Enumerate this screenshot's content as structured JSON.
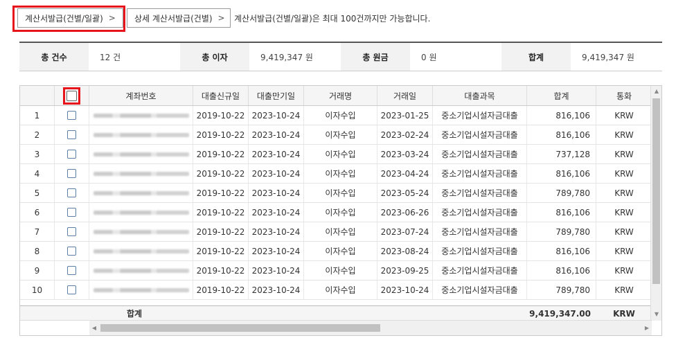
{
  "buttons": {
    "bulk_issue": "계산서발급(건별/일괄)",
    "detail_issue": "상세 계산서발급(건별)",
    "chevron": ">"
  },
  "notice": "계산서발급(건별/일괄)은 최대 100건까지만 가능합니다.",
  "summary": {
    "count_label": "총 건수",
    "count_value": "12 건",
    "interest_label": "총 이자",
    "interest_value": "9,419,347 원",
    "principal_label": "총 원금",
    "principal_value": "0 원",
    "total_label": "합계",
    "total_value": "9,419,347 원"
  },
  "table": {
    "headers": [
      "",
      "",
      "계좌번호",
      "대출신규일",
      "대출만기일",
      "거래명",
      "거래일",
      "대출과목",
      "합계",
      "통화"
    ],
    "rows": [
      {
        "no": "1",
        "open": "2019-10-22",
        "due": "2023-10-24",
        "type": "이자수입",
        "date": "2023-01-25",
        "product": "중소기업시설자금대출",
        "total": "816,106",
        "cur": "KRW"
      },
      {
        "no": "2",
        "open": "2019-10-22",
        "due": "2023-10-24",
        "type": "이자수입",
        "date": "2023-02-24",
        "product": "중소기업시설자금대출",
        "total": "816,106",
        "cur": "KRW"
      },
      {
        "no": "3",
        "open": "2019-10-22",
        "due": "2023-10-24",
        "type": "이자수입",
        "date": "2023-03-24",
        "product": "중소기업시설자금대출",
        "total": "737,128",
        "cur": "KRW"
      },
      {
        "no": "4",
        "open": "2019-10-22",
        "due": "2023-10-24",
        "type": "이자수입",
        "date": "2023-04-24",
        "product": "중소기업시설자금대출",
        "total": "816,106",
        "cur": "KRW"
      },
      {
        "no": "5",
        "open": "2019-10-22",
        "due": "2023-10-24",
        "type": "이자수입",
        "date": "2023-05-24",
        "product": "중소기업시설자금대출",
        "total": "789,780",
        "cur": "KRW"
      },
      {
        "no": "6",
        "open": "2019-10-22",
        "due": "2023-10-24",
        "type": "이자수입",
        "date": "2023-06-26",
        "product": "중소기업시설자금대출",
        "total": "816,106",
        "cur": "KRW"
      },
      {
        "no": "7",
        "open": "2019-10-22",
        "due": "2023-10-24",
        "type": "이자수입",
        "date": "2023-07-24",
        "product": "중소기업시설자금대출",
        "total": "789,780",
        "cur": "KRW"
      },
      {
        "no": "8",
        "open": "2019-10-22",
        "due": "2023-10-24",
        "type": "이자수입",
        "date": "2023-08-24",
        "product": "중소기업시설자금대출",
        "total": "816,106",
        "cur": "KRW"
      },
      {
        "no": "9",
        "open": "2019-10-22",
        "due": "2023-10-24",
        "type": "이자수입",
        "date": "2023-09-25",
        "product": "중소기업시설자금대출",
        "total": "816,106",
        "cur": "KRW"
      },
      {
        "no": "10",
        "open": "2019-10-22",
        "due": "2023-10-24",
        "type": "이자수입",
        "date": "2023-10-24",
        "product": "중소기업시설자금대출",
        "total": "789,780",
        "cur": "KRW"
      }
    ],
    "footer": {
      "label": "합계",
      "total": "9,419,347.00",
      "cur": "KRW"
    }
  }
}
